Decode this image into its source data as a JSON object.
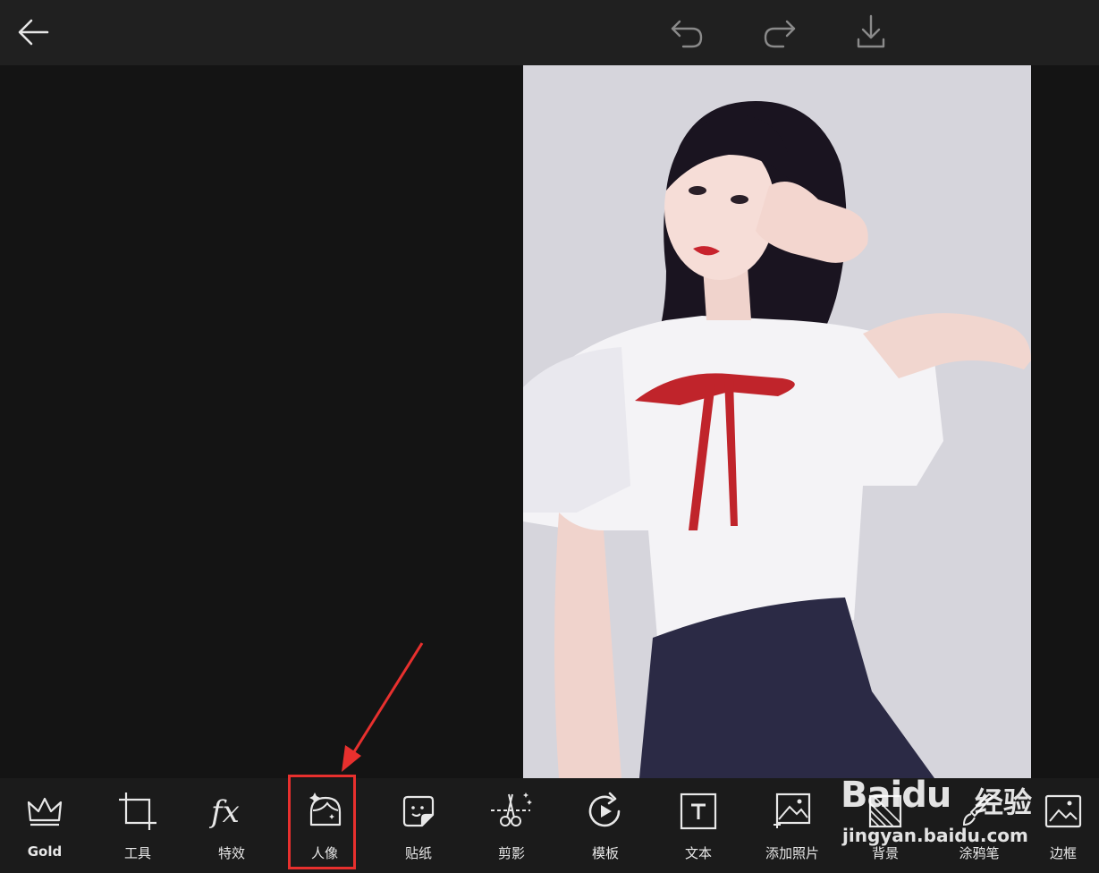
{
  "top_bar": {
    "back_icon": "arrow-left-icon",
    "undo_icon": "undo-icon",
    "redo_icon": "redo-icon",
    "download_icon": "download-icon"
  },
  "canvas": {
    "photo_subject": "portrait-photo"
  },
  "toolbar": {
    "items": [
      {
        "label": "Gold",
        "icon": "crown-icon"
      },
      {
        "label": "工具",
        "icon": "crop-icon"
      },
      {
        "label": "特效",
        "icon": "fx-icon"
      },
      {
        "label": "人像",
        "icon": "portrait-icon"
      },
      {
        "label": "贴纸",
        "icon": "sticker-icon"
      },
      {
        "label": "剪影",
        "icon": "cutout-icon"
      },
      {
        "label": "模板",
        "icon": "template-icon"
      },
      {
        "label": "文本",
        "icon": "text-icon"
      },
      {
        "label": "添加照片",
        "icon": "add-photo-icon"
      },
      {
        "label": "背景",
        "icon": "background-icon"
      },
      {
        "label": "涂鸦笔",
        "icon": "brush-icon"
      },
      {
        "label": "边框",
        "icon": "frame-icon"
      }
    ]
  },
  "watermark": {
    "brand": "Baidu",
    "cn": "经验",
    "url": "jingyan.baidu.com"
  },
  "colors": {
    "highlight": "#e8302e",
    "toolbar_bg": "#1b1b1b",
    "topbar_bg": "#202020"
  }
}
